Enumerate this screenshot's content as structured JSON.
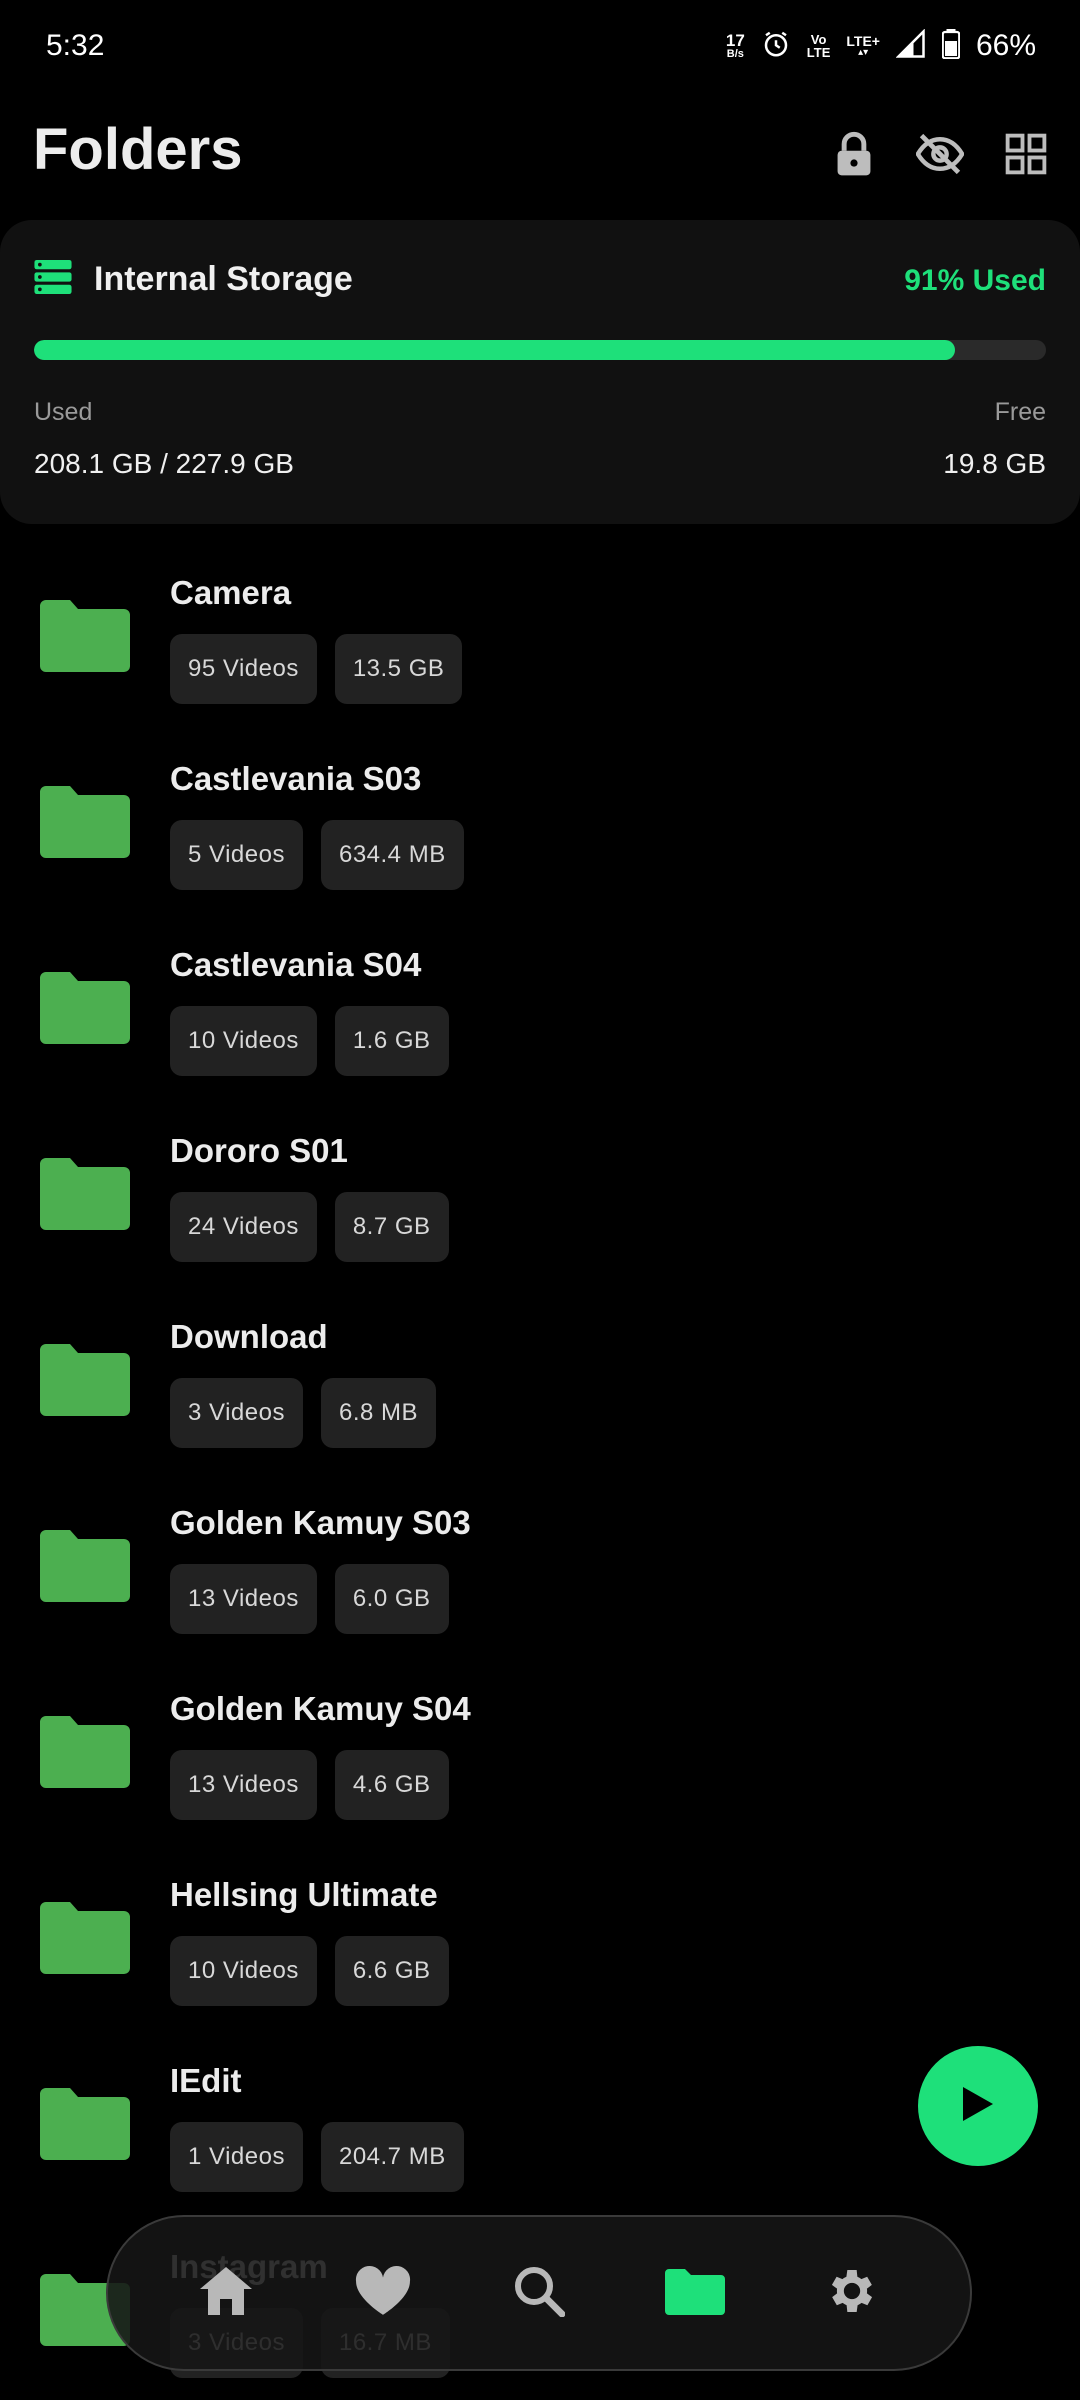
{
  "status_bar": {
    "time": "5:32",
    "net_speed_value": "17",
    "net_speed_unit": "B/s",
    "volte_top": "Vo",
    "volte_bottom": "LTE",
    "lte_label": "LTE+",
    "battery_percent": "66%"
  },
  "header": {
    "title": "Folders"
  },
  "storage": {
    "title": "Internal Storage",
    "percent_label": "91% Used",
    "used_fraction": 0.91,
    "used_label": "Used",
    "free_label": "Free",
    "used_value": "208.1 GB / 227.9 GB",
    "free_value": "19.8 GB"
  },
  "folders": [
    {
      "name": "Camera",
      "count": "95 Videos",
      "size": "13.5 GB"
    },
    {
      "name": "Castlevania S03",
      "count": "5 Videos",
      "size": "634.4 MB"
    },
    {
      "name": "Castlevania S04",
      "count": "10 Videos",
      "size": "1.6 GB"
    },
    {
      "name": "Dororo S01",
      "count": "24 Videos",
      "size": "8.7 GB"
    },
    {
      "name": "Download",
      "count": "3 Videos",
      "size": "6.8 MB"
    },
    {
      "name": "Golden Kamuy S03",
      "count": "13 Videos",
      "size": "6.0 GB"
    },
    {
      "name": "Golden Kamuy S04",
      "count": "13 Videos",
      "size": "4.6 GB"
    },
    {
      "name": "Hellsing Ultimate",
      "count": "10 Videos",
      "size": "6.6 GB"
    },
    {
      "name": "IEdit",
      "count": "1 Videos",
      "size": "204.7 MB"
    },
    {
      "name": "Instagram",
      "count": "3 Videos",
      "size": "16.7 MB"
    }
  ],
  "colors": {
    "accent": "#1ee07a",
    "folder": "#4caf50",
    "background": "#000000"
  },
  "nav": {
    "items": [
      "home-icon",
      "heart-icon",
      "search-icon",
      "folder-icon",
      "gear-icon"
    ],
    "active": "folder-icon"
  }
}
